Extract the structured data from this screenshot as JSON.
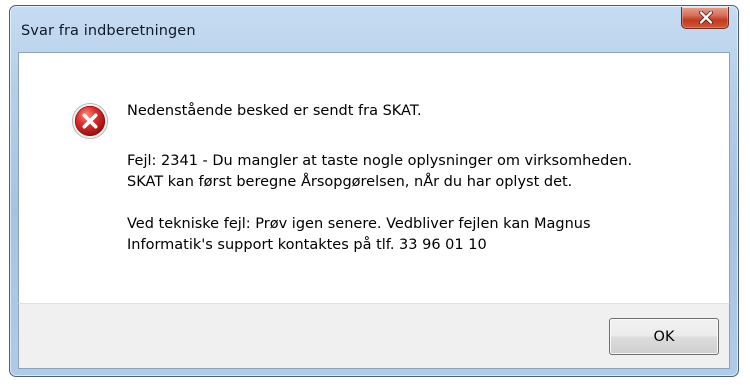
{
  "dialog": {
    "title": "Svar fra indberetningen",
    "close_label": "x"
  },
  "message": {
    "line1": "Nedenstående besked er sendt fra SKAT.",
    "line2": "Fejl: 2341 - Du mangler at taste nogle oplysninger om virksomheden.",
    "line3": "SKAT kan først beregne Årsopgørelsen, nÅr du har oplyst det.",
    "line4": "Ved tekniske fejl: Prøv igen senere. Vedbliver fejlen kan Magnus",
    "line5": "Informatik's support kontaktes på tlf. 33 96 01 10"
  },
  "buttons": {
    "ok_label": "OK"
  },
  "icons": {
    "error": "error-icon",
    "close": "close-icon"
  },
  "colors": {
    "title_bar": "#a7c3e1",
    "close_button": "#c23a20",
    "error_red": "#d4262a"
  }
}
